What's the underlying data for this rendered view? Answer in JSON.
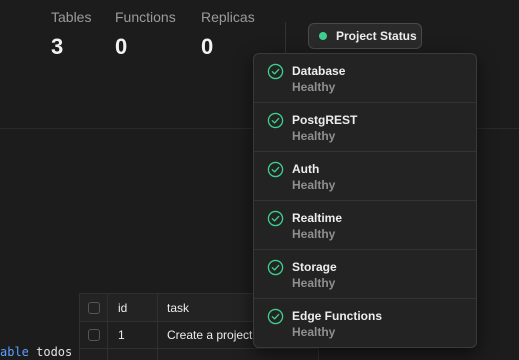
{
  "stats": [
    {
      "label": "Tables",
      "value": "3"
    },
    {
      "label": "Functions",
      "value": "0"
    },
    {
      "label": "Replicas",
      "value": "0"
    }
  ],
  "status_button": {
    "label": "Project Status",
    "dot_color": "#3ecf8e"
  },
  "services": [
    {
      "name": "Database",
      "status": "Healthy"
    },
    {
      "name": "PostgREST",
      "status": "Healthy"
    },
    {
      "name": "Auth",
      "status": "Healthy"
    },
    {
      "name": "Realtime",
      "status": "Healthy"
    },
    {
      "name": "Storage",
      "status": "Healthy"
    },
    {
      "name": "Edge Functions",
      "status": "Healthy"
    }
  ],
  "table": {
    "columns": [
      "id",
      "task"
    ],
    "rows": [
      {
        "id": "1",
        "task": "Create a project"
      }
    ]
  },
  "code": {
    "keyword": "able",
    "rest": " todos "
  },
  "colors": {
    "accent": "#3ecf8e",
    "background": "#1c1c1c",
    "panel": "#232323"
  }
}
